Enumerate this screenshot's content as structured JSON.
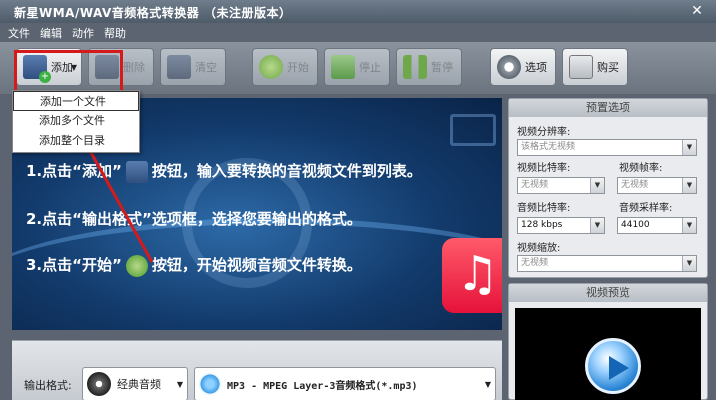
{
  "window": {
    "title": "新星WMA/WAV音频格式转换器 （未注册版本）",
    "close_glyph": "✕"
  },
  "menu": [
    "文件",
    "编辑",
    "动作",
    "帮助"
  ],
  "toolbar": {
    "add_label": "添加",
    "delete_label": "删除",
    "clear_label": "清空",
    "start_label": "开始",
    "stop_label": "停止",
    "pause_label": "暂停",
    "options_label": "选项",
    "buy_label": "购买"
  },
  "add_dropdown": {
    "items": [
      "添加一个文件",
      "添加多个文件",
      "添加整个目录"
    ]
  },
  "banner": {
    "line1_a": "1.点击“添加”",
    "line1_b": "按钮，输入要转换的音视频文件到列表。",
    "line2": "2.点击“输出格式”选项框，选择您要输出的格式。",
    "line3_a": "3.点击“开始”",
    "line3_b": "按钮，开始视频音频文件转换。",
    "music_glyph": "♫"
  },
  "preset_panel": {
    "title": "预置选项",
    "resolution_label": "视频分辨率:",
    "resolution_value": "该格式无视频",
    "video_bitrate_label": "视频比特率:",
    "video_bitrate_value": "无视频",
    "frame_rate_label": "视频帧率:",
    "frame_rate_value": "无视频",
    "audio_bitrate_label": "音频比特率:",
    "audio_bitrate_value": "128 kbps",
    "sample_rate_label": "音频采样率:",
    "sample_rate_value": "44100",
    "scale_label": "视频缩放:",
    "scale_value": "无视频"
  },
  "preview": {
    "title": "视频预览"
  },
  "output": {
    "label": "输出格式:",
    "category": "经典音频",
    "format": "MP3 - MPEG Layer-3音频格式(*.mp3)"
  },
  "colors": {
    "annotation_red": "#d41a1a",
    "music_tile": "#e5123a"
  }
}
